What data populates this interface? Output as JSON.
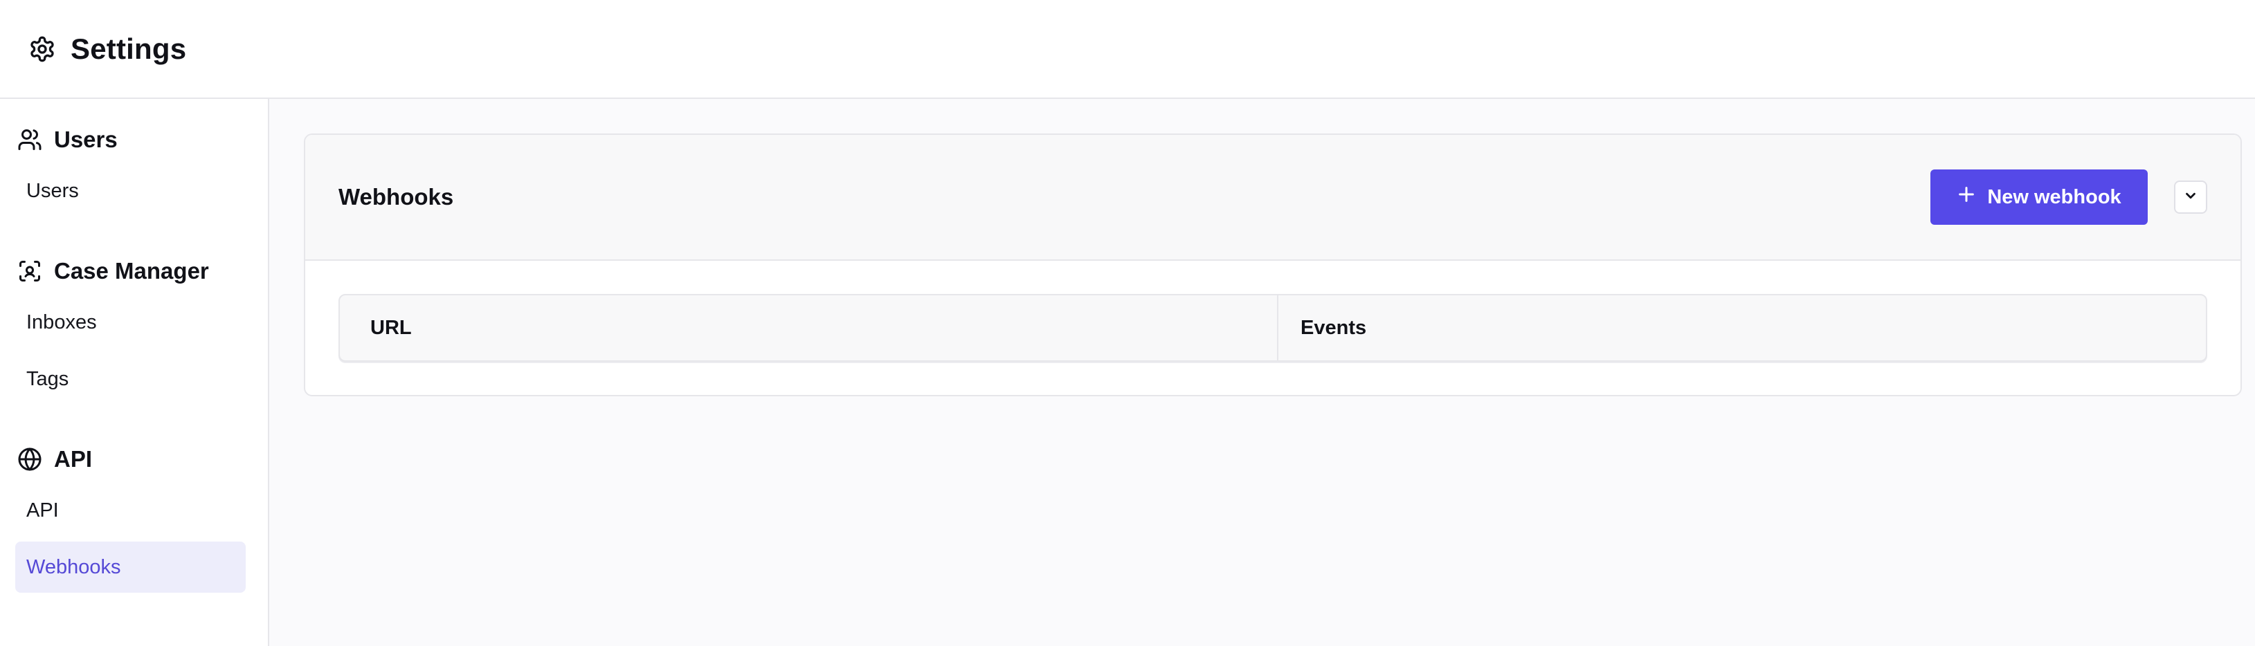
{
  "header": {
    "title": "Settings",
    "icon": "gear-icon"
  },
  "sidebar": {
    "sections": [
      {
        "title": "Users",
        "icon": "users-icon",
        "items": [
          {
            "label": "Users",
            "active": false
          }
        ]
      },
      {
        "title": "Case Manager",
        "icon": "scan-face-icon",
        "items": [
          {
            "label": "Inboxes",
            "active": false
          },
          {
            "label": "Tags",
            "active": false
          }
        ]
      },
      {
        "title": "API",
        "icon": "globe-icon",
        "items": [
          {
            "label": "API",
            "active": false
          },
          {
            "label": "Webhooks",
            "active": true
          }
        ]
      }
    ]
  },
  "main": {
    "card": {
      "title": "Webhooks",
      "new_button_label": "New webhook",
      "table": {
        "columns": [
          "URL",
          "Events"
        ],
        "rows": []
      }
    }
  },
  "colors": {
    "accent": "#5549e8",
    "active_nav_bg": "#ededfb",
    "active_nav_text": "#5549d6"
  }
}
